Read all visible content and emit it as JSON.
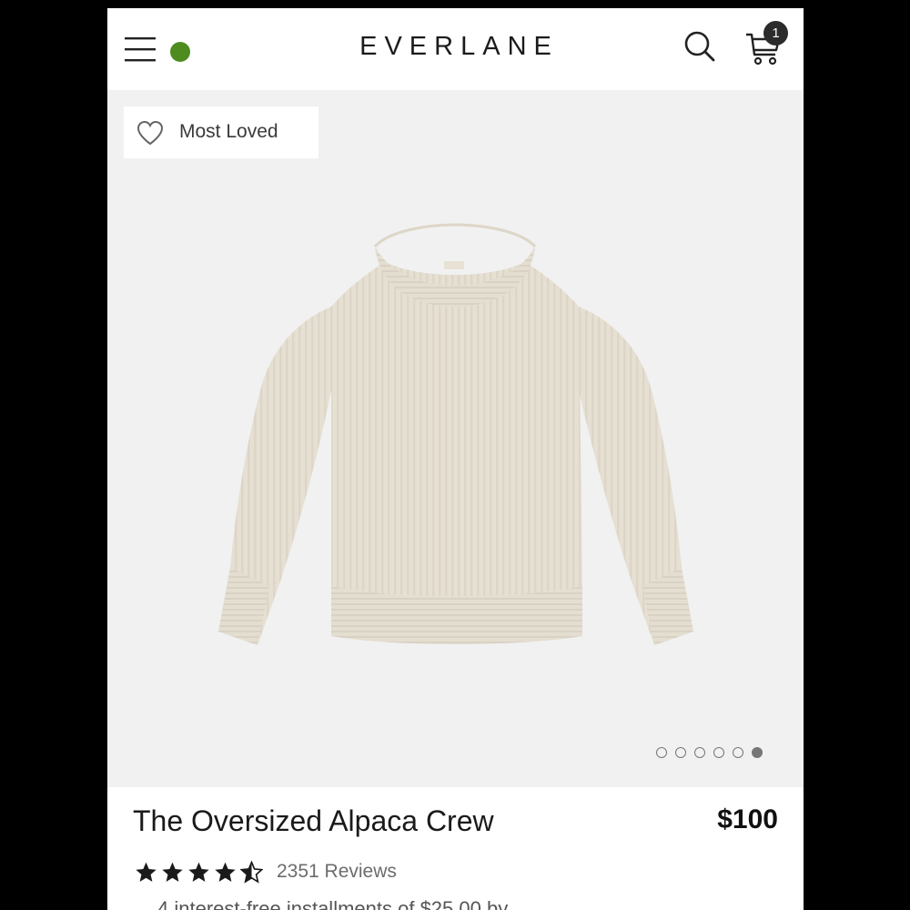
{
  "header": {
    "brand": "EVERLANE",
    "status_dot_color": "#4e8c1f",
    "cart_count": "1",
    "menu_icon": "hamburger-menu-icon",
    "search_icon": "search-icon",
    "cart_icon": "cart-icon"
  },
  "gallery": {
    "badge_label": "Most Loved",
    "badge_icon": "heart-outline-icon",
    "image_alt": "The Oversized Alpaca Crew sweater in cream",
    "slide_count": 6,
    "active_slide": 6
  },
  "product": {
    "name": "The Oversized Alpaca Crew",
    "price": "$100",
    "rating": 4.5,
    "review_count": "2351 Reviews",
    "installment_text": "4 interest-free installments of $25.00 by"
  }
}
